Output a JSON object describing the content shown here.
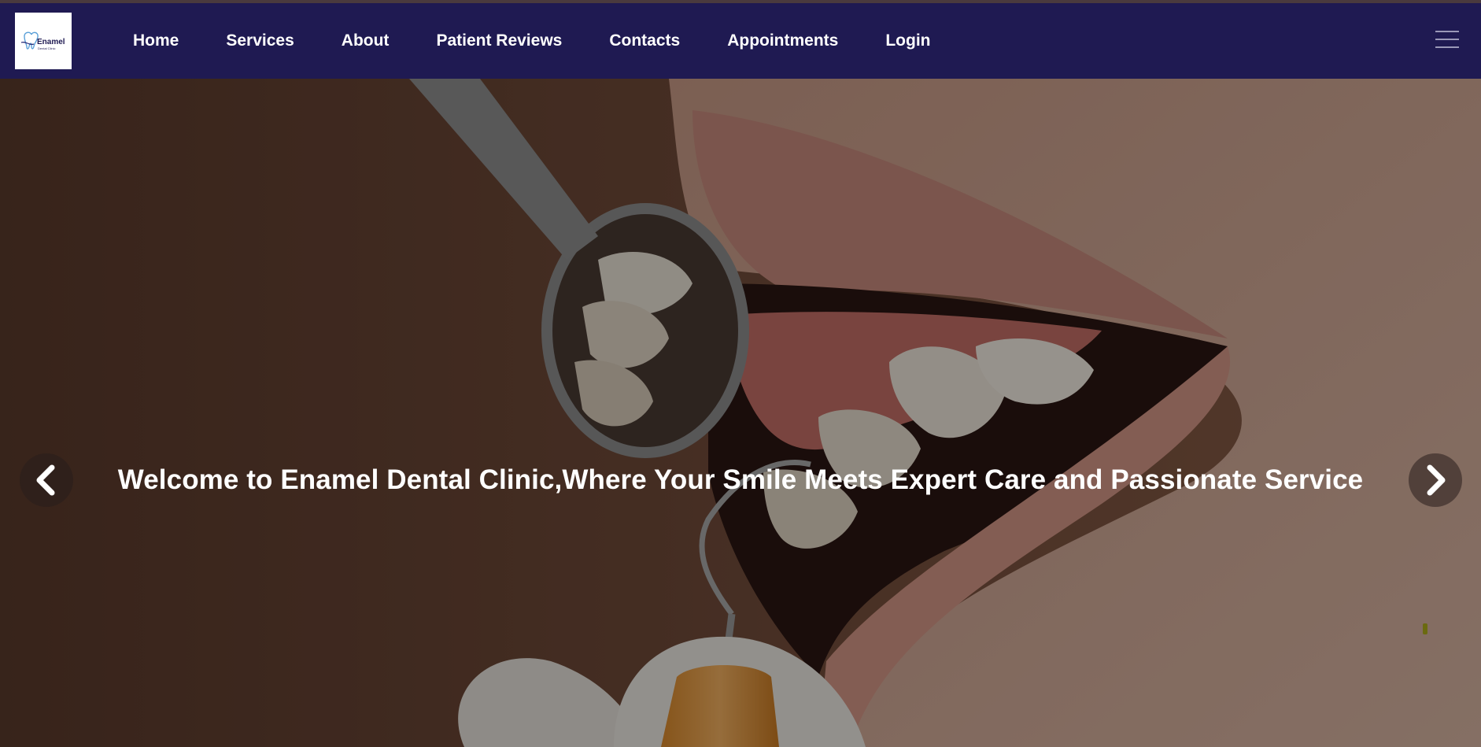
{
  "brand": {
    "logo_text": "Enamel",
    "logo_subtext": "Dental Clinic"
  },
  "nav": {
    "items": [
      {
        "label": "Home"
      },
      {
        "label": "Services"
      },
      {
        "label": "About"
      },
      {
        "label": "Patient Reviews"
      },
      {
        "label": "Contacts"
      },
      {
        "label": "Appointments"
      },
      {
        "label": "Login"
      }
    ],
    "menu_icon": "hamburger-menu-icon"
  },
  "hero": {
    "title": "Welcome to Enamel Dental Clinic,Where Your Smile Meets Expert Care and Passionate Service",
    "prev_icon": "chevron-left-icon",
    "next_icon": "chevron-right-icon"
  },
  "colors": {
    "navbar_bg": "#1f1a52",
    "nav_text": "#ffffff",
    "hero_text": "#ffffff"
  }
}
